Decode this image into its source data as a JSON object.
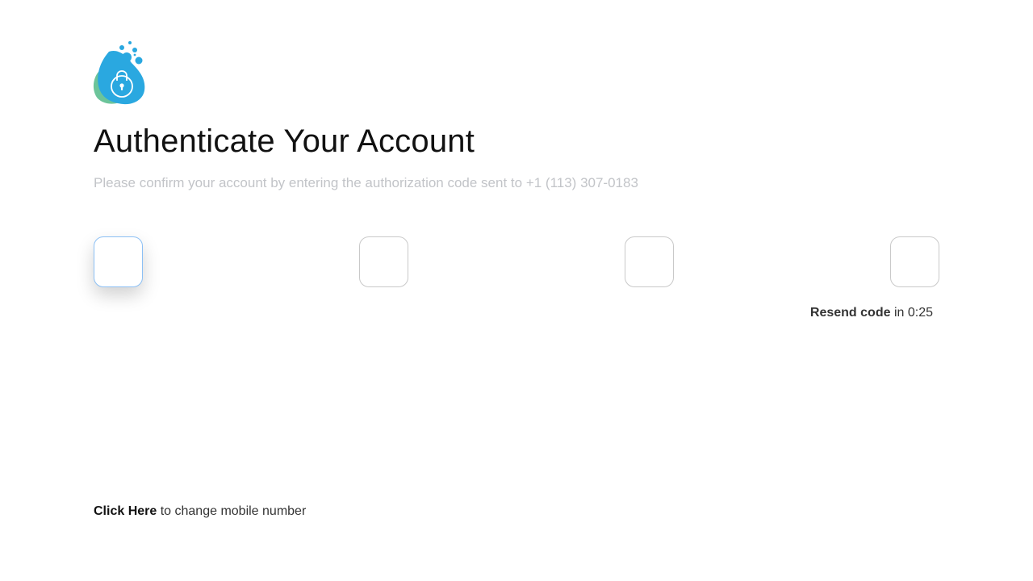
{
  "logo": {
    "icon": "lock-blob-icon",
    "colors": {
      "primary": "#2aa8e0",
      "secondary": "#6cc49a",
      "lock": "#ffffff"
    }
  },
  "header": {
    "title": "Authenticate Your Account",
    "subtitle": "Please confirm your account by entering the authorization code sent to +1 (113) 307-0183"
  },
  "code_inputs": [
    {
      "value": "",
      "active": true
    },
    {
      "value": "",
      "active": false
    },
    {
      "value": "",
      "active": false
    },
    {
      "value": "",
      "active": false
    }
  ],
  "resend": {
    "link_label": "Resend code",
    "suffix": "in 0:25"
  },
  "change_number": {
    "link_label": "Click Here",
    "suffix": "to change mobile number"
  },
  "colors": {
    "accent": "#8cc0f5",
    "subtitle": "#c2c4c8",
    "box_border": "#c9c9c9"
  }
}
